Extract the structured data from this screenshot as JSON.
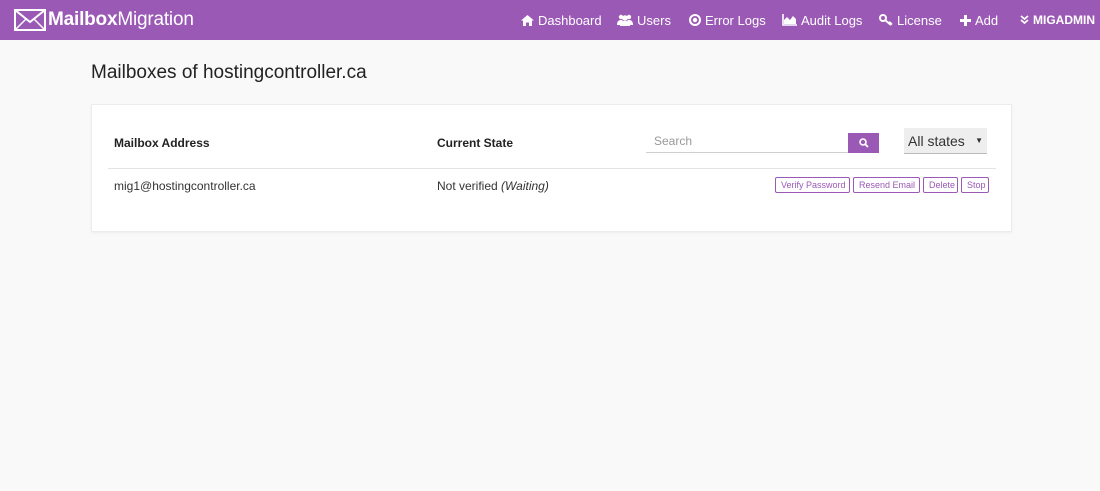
{
  "brand": {
    "part1": "Mailbox",
    "part2": "Migration",
    "icon": "envelope-icon"
  },
  "nav": [
    {
      "label": "Dashboard",
      "icon": "home-icon"
    },
    {
      "label": "Users",
      "icon": "users-icon"
    },
    {
      "label": "Error Logs",
      "icon": "error-log-icon"
    },
    {
      "label": "Audit Logs",
      "icon": "area-chart-icon"
    },
    {
      "label": "License",
      "icon": "key-icon"
    },
    {
      "label": "Add",
      "icon": "plus-icon"
    },
    {
      "label": "MIGADMIN",
      "icon": "double-chevron-down-icon"
    }
  ],
  "page": {
    "title": "Mailboxes of hostingcontroller.ca"
  },
  "table": {
    "headers": {
      "address": "Mailbox Address",
      "state": "Current State"
    },
    "search_placeholder": "Search",
    "filter_value": "All states",
    "rows": [
      {
        "address": "mig1@hostingcontroller.ca",
        "state": "Not verified",
        "substate": "(Waiting)",
        "actions": {
          "verify": "Verify Password",
          "resend": "Resend Email",
          "delete": "Delete",
          "stop": "Stop"
        }
      }
    ]
  },
  "colors": {
    "accent": "#9b59b6",
    "background": "#f9f9f9"
  }
}
